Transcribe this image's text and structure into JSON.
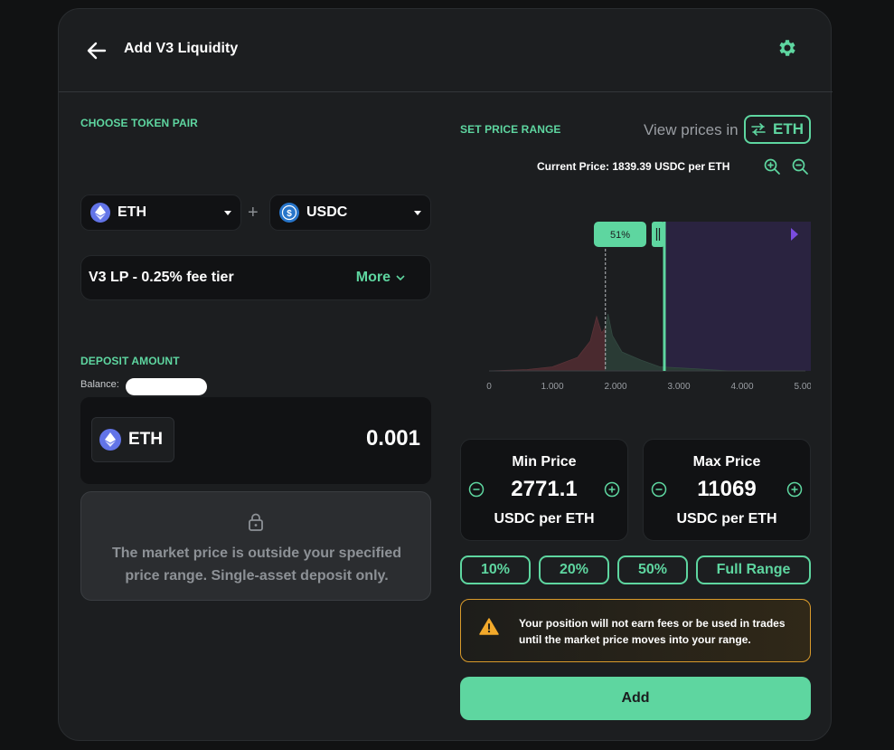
{
  "header": {
    "title": "Add V3 Liquidity"
  },
  "token_pair": {
    "section_label": "CHOOSE TOKEN PAIR",
    "token_a": "ETH",
    "plus": "+",
    "token_b": "USDC",
    "fee_tier": "V3 LP - 0.25% fee tier",
    "more_label": "More"
  },
  "deposit": {
    "section_label": "DEPOSIT AMOUNT",
    "balance_label": "Balance:",
    "token": "ETH",
    "amount": "0.001",
    "lock_message": "The market price is outside your specified price range. Single-asset deposit only."
  },
  "price_range": {
    "section_label": "SET PRICE RANGE",
    "view_prices_label": "View prices in",
    "view_token": "ETH",
    "current_price": "Current Price: 1839.39 USDC per ETH",
    "min": {
      "title": "Min Price",
      "value": "2771.1",
      "unit": "USDC per ETH"
    },
    "max": {
      "title": "Max Price",
      "value": "11069",
      "unit": "USDC per ETH"
    },
    "presets": [
      "10%",
      "20%",
      "50%",
      "Full Range"
    ],
    "warning_line1": "Your position will not earn fees or be used in trades",
    "warning_line2": "until the market price moves into your range."
  },
  "chart_data": {
    "type": "area",
    "x_ticks": [
      "0",
      "1,000",
      "2,000",
      "3,000",
      "4,000",
      "5,000"
    ],
    "xlim": [
      0,
      5000
    ],
    "current_price": 1839.39,
    "range_min": 2771.1,
    "range_max": 11069,
    "handle_label": "51%",
    "liquidity_left": {
      "x": [
        0,
        600,
        1000,
        1400,
        1600,
        1700,
        1780,
        1839
      ],
      "y": [
        0,
        0.01,
        0.03,
        0.1,
        0.22,
        0.4,
        0.28,
        0.32
      ]
    },
    "liquidity_right": {
      "x": [
        1839,
        1880,
        1950,
        2100,
        2400,
        2700,
        3300,
        3800
      ],
      "y": [
        0.3,
        0.42,
        0.26,
        0.14,
        0.08,
        0.03,
        0.015,
        0
      ]
    }
  },
  "add_button": "Add",
  "colors": {
    "accent": "#5ed6a0",
    "warning": "#d99a2b",
    "range_fill": "#2a2340",
    "range_marker": "#7a4ce0"
  }
}
